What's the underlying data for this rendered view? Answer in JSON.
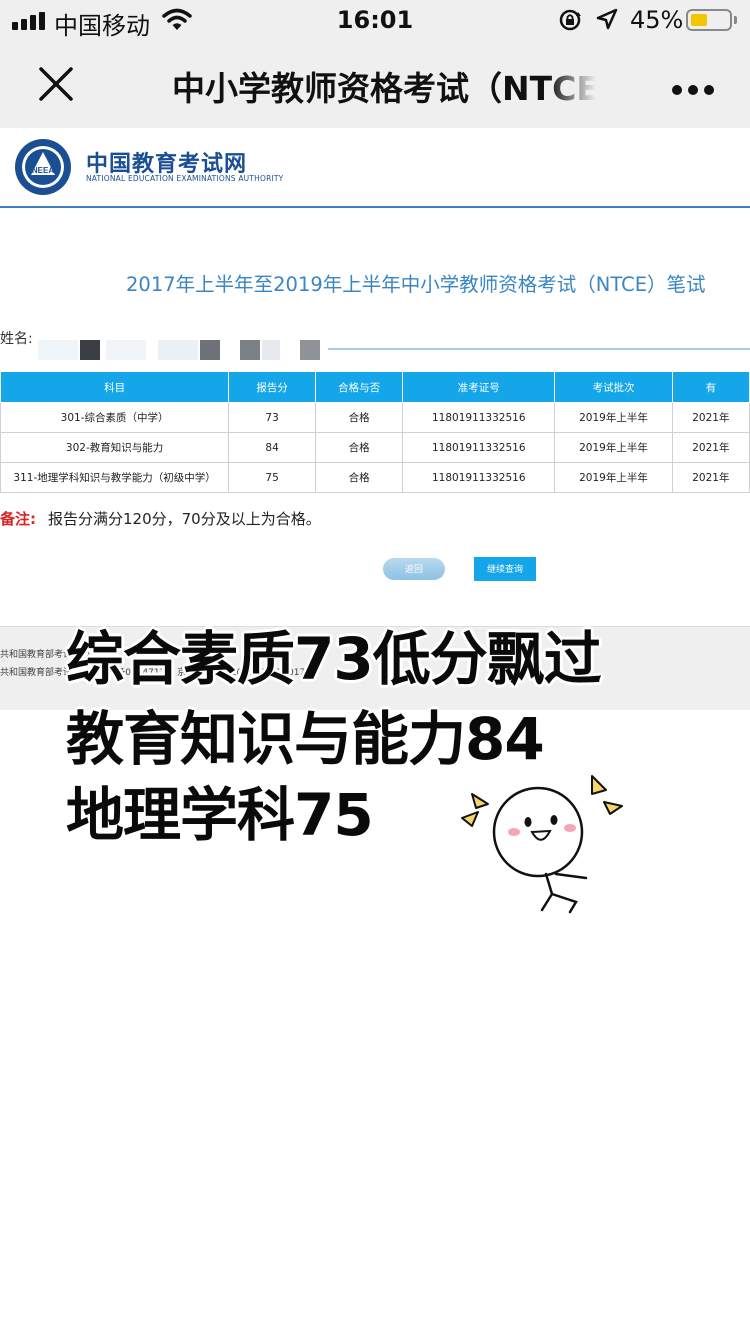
{
  "status_bar": {
    "carrier": "中国移动",
    "time": "16:01",
    "battery_percent": "45%",
    "battery_level": 0.45,
    "icons": [
      "signal-icon",
      "wifi-icon",
      "orientation-lock-icon",
      "location-icon",
      "battery-icon"
    ]
  },
  "nav": {
    "title": "中小学教师资格考试（NTCE",
    "close_icon": "close-icon",
    "more_icon": "more-icon"
  },
  "site": {
    "logo_name": "中国教育考试网",
    "logo_subtitle": "NATIONAL EDUCATION EXAMINATIONS AUTHORITY",
    "logo_emblem_text": "NEEA"
  },
  "page": {
    "heading": "2017年上半年至2019年上半年中小学教师资格考试（NTCE）笔试",
    "name_label": "姓名:"
  },
  "table": {
    "headers": [
      "科目",
      "报告分",
      "合格与否",
      "准考证号",
      "考试批次",
      "有"
    ],
    "rows": [
      [
        "301-综合素质（中学）",
        "73",
        "合格",
        "11801911332516",
        "2019年上半年",
        "2021年"
      ],
      [
        "302-教育知识与能力",
        "84",
        "合格",
        "11801911332516",
        "2019年上半年",
        "2021年"
      ],
      [
        "311-地理学科知识与教学能力（初级中学）",
        "75",
        "合格",
        "11801911332516",
        "2019年上半年",
        "2021年"
      ]
    ]
  },
  "note": {
    "label": "备注:",
    "text": "报告分满分120分，70分及以上为合格。"
  },
  "buttons": {
    "back": "返回",
    "continue": "继续查询"
  },
  "footer": {
    "line1": "共和国教育部考试中心",
    "line2": "共和国教育部考试中心 京ICP备0604712号  京公网安备 11010802430017号"
  },
  "overlay": {
    "line1": "综合素质73低分飘过",
    "line2": "教育知识与能力84",
    "line3": "地理学科75"
  },
  "colors": {
    "table_header": "#14a6e8",
    "heading": "#3a86c4",
    "note_label": "#dd2222",
    "logo": "#1b4f93"
  }
}
